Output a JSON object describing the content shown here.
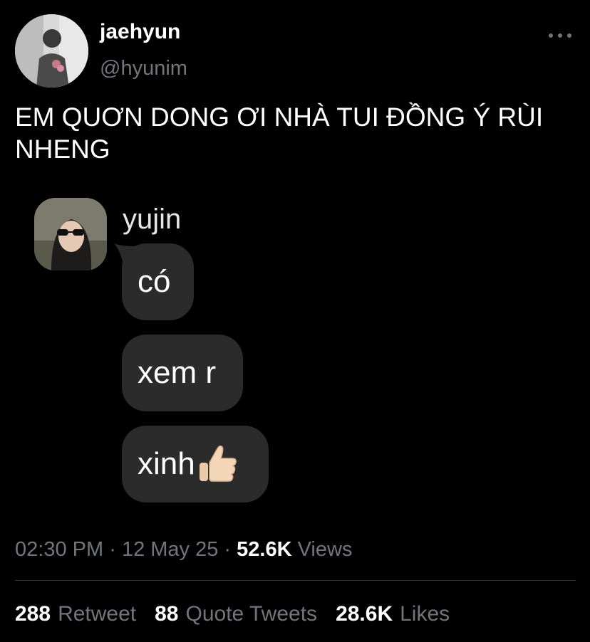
{
  "tweet": {
    "author": {
      "display_name": "jaehyun",
      "handle": "@hyunim",
      "avatar": "profile-photo-icon"
    },
    "more_icon": "more-horizontal-icon",
    "text": "EM QUƠN DONG ƠI NHÀ TUI ĐỒNG Ý RÙI\nNHENG",
    "attachment": {
      "chat_contact_name": "yujin",
      "chat_avatar": "contact-photo-icon",
      "messages": [
        "có",
        "xem r",
        "xinh"
      ],
      "emoji": "thumbs-up-icon"
    },
    "meta": {
      "time": "02:30 PM",
      "separator": "·",
      "date": "12 May 25",
      "views_count": "52.6K",
      "views_label": "Views"
    },
    "stats": {
      "retweets": {
        "count": "288",
        "label": "Retweet"
      },
      "quotes": {
        "count": "88",
        "label": "Quote Tweets"
      },
      "likes": {
        "count": "28.6K",
        "label": "Likes"
      }
    }
  },
  "colors": {
    "background": "#000000",
    "primary_text": "#ffffff",
    "secondary_text": "#71767b",
    "bubble": "#2b2b2b",
    "divider": "#2f3336"
  }
}
